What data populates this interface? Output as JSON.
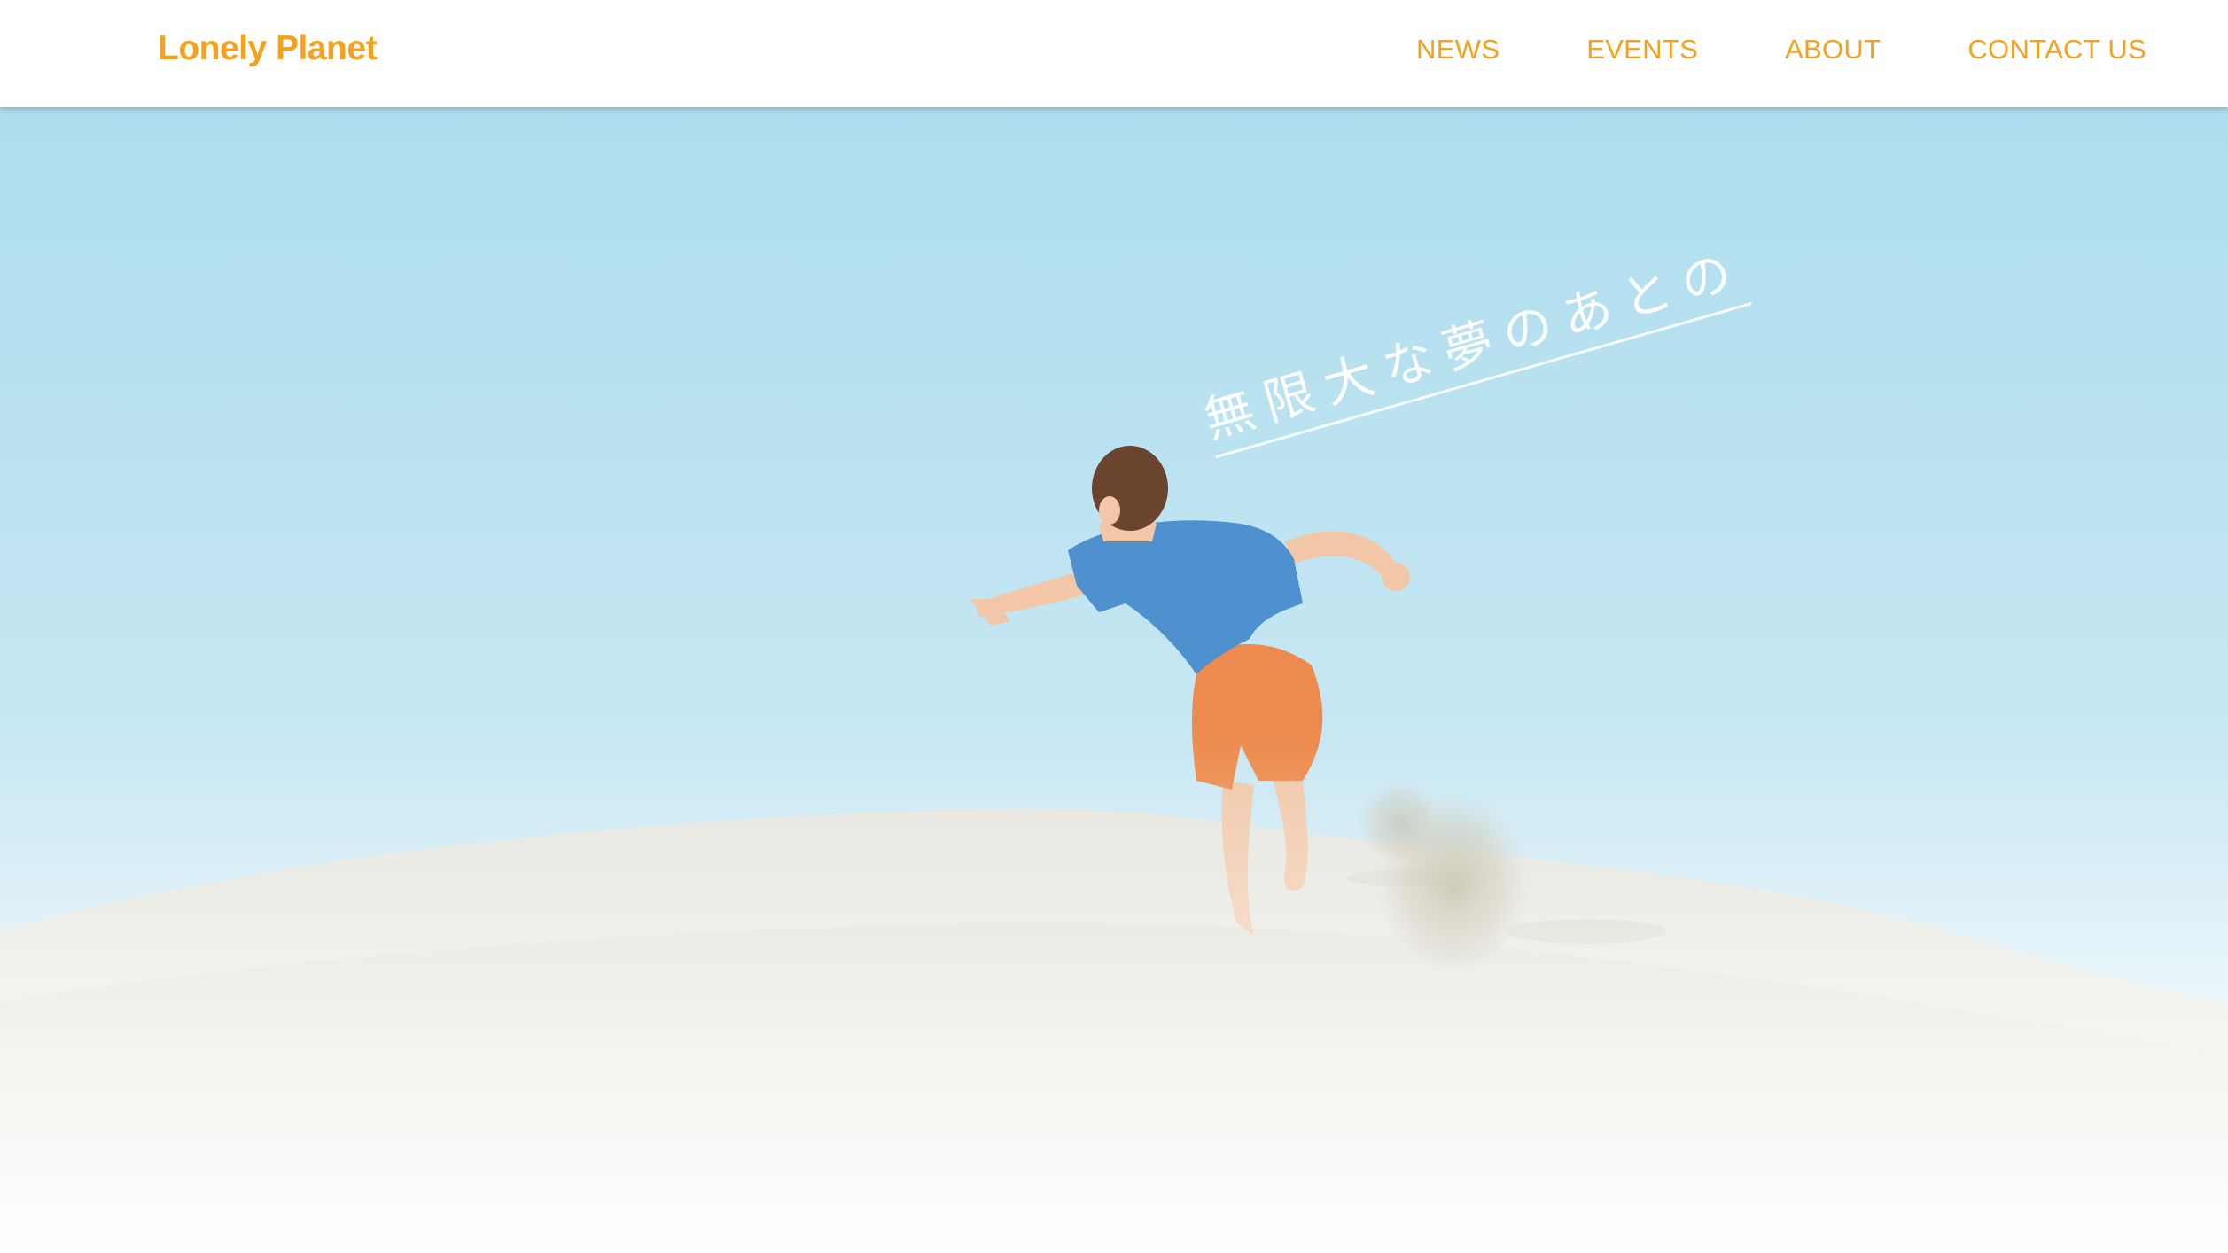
{
  "brand": {
    "name": "Lonely Planet",
    "color": "#F5A11C"
  },
  "nav": {
    "items": [
      {
        "label": "NEWS"
      },
      {
        "label": "EVENTS"
      },
      {
        "label": "ABOUT"
      },
      {
        "label": "CONTACT US"
      }
    ],
    "color": "#F5A11C"
  },
  "hero": {
    "tagline": "無限大な夢のあとの",
    "colors": {
      "sky_top": "#ADDDEE",
      "sky_bottom": "#DDEFF7",
      "sand": "#E6E6DE",
      "shirt": "#4F90CF",
      "shorts": "#EC8B4D",
      "skin": "#F1C7A7",
      "hair": "#6B4430"
    },
    "image_icon": "boy-running-on-sand-dune-photo"
  }
}
